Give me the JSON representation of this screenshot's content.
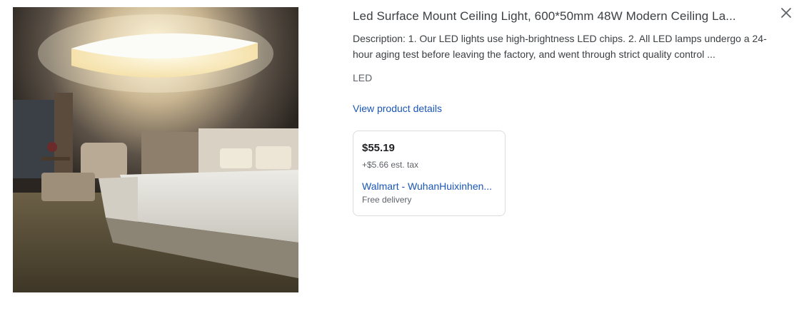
{
  "product": {
    "title": "Led Surface Mount Ceiling Light, 600*50mm 48W Modern Ceiling La...",
    "description": "Description: 1. Our LED lights use high-brightness LED chips. 2. All LED lamps undergo a 24-hour aging test before leaving the factory, and went through strict quality control ...",
    "brand": "LED",
    "view_details_label": "View product details"
  },
  "offer": {
    "price": "$55.19",
    "tax": "+$5.66 est. tax",
    "seller": "Walmart - WuhanHuixinhen...",
    "delivery": "Free delivery"
  },
  "icons": {
    "close": "close-icon"
  },
  "colors": {
    "link": "#1a56b7",
    "title": "#3c4043",
    "secondary": "#5f6368",
    "card_border": "#dadce0"
  }
}
